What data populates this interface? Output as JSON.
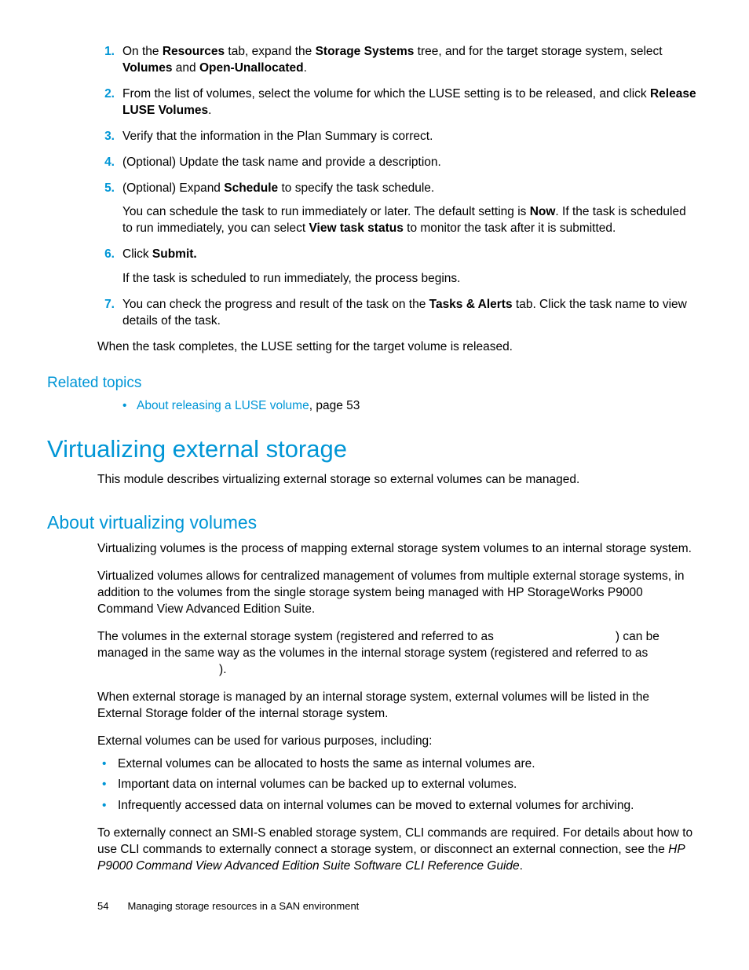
{
  "steps": [
    {
      "n": "1.",
      "parts": [
        {
          "t": "On the "
        },
        {
          "t": "Resources",
          "b": true
        },
        {
          "t": " tab, expand the "
        },
        {
          "t": "Storage Systems",
          "b": true
        },
        {
          "t": " tree, and for the target storage system, select "
        },
        {
          "t": "Volumes",
          "b": true
        },
        {
          "t": " and "
        },
        {
          "t": "Open-Unallocated",
          "b": true
        },
        {
          "t": "."
        }
      ]
    },
    {
      "n": "2.",
      "parts": [
        {
          "t": "From the list of volumes, select the volume for which the LUSE setting is to be released, and click "
        },
        {
          "t": "Release LUSE Volumes",
          "b": true
        },
        {
          "t": "."
        }
      ]
    },
    {
      "n": "3.",
      "parts": [
        {
          "t": "Verify that the information in the Plan Summary is correct."
        }
      ]
    },
    {
      "n": "4.",
      "parts": [
        {
          "t": "(Optional) Update the task name and provide a description."
        }
      ]
    },
    {
      "n": "5.",
      "parts": [
        {
          "t": "(Optional) Expand "
        },
        {
          "t": "Schedule",
          "b": true
        },
        {
          "t": " to specify the task schedule."
        }
      ],
      "sub": [
        {
          "t": "You can schedule the task to run immediately or later. The default setting is "
        },
        {
          "t": "Now",
          "b": true
        },
        {
          "t": ". If the task is scheduled to run immediately, you can select "
        },
        {
          "t": "View task status",
          "b": true
        },
        {
          "t": " to monitor the task after it is submitted."
        }
      ]
    },
    {
      "n": "6.",
      "parts": [
        {
          "t": "Click "
        },
        {
          "t": "Submit.",
          "b": true
        }
      ],
      "sub": [
        {
          "t": "If the task is scheduled to run immediately, the process begins."
        }
      ]
    },
    {
      "n": "7.",
      "parts": [
        {
          "t": "You can check the progress and result of the task on the "
        },
        {
          "t": "Tasks & Alerts",
          "b": true
        },
        {
          "t": " tab. Click the task name to view details of the task."
        }
      ]
    }
  ],
  "after_steps": "When the task completes, the LUSE setting for the target volume is released.",
  "related_heading": "Related topics",
  "related_link": "About releasing a LUSE volume",
  "related_after": ", page 53",
  "h1": "Virtualizing external storage",
  "h1_intro": "This module describes virtualizing external storage so external volumes can be managed.",
  "h2": "About virtualizing volumes",
  "p1": "Virtualizing volumes is the process of mapping external storage system volumes to an internal storage system.",
  "p2": "Virtualized volumes allows for centralized management of volumes from multiple external storage systems, in addition to the volumes from the single storage system being managed with HP StorageWorks P9000 Command View Advanced Edition Suite.",
  "p3_a": "The volumes in the external storage system (registered and referred to as ",
  "p3_gap1": "                                   ",
  "p3_b": ") can be managed in the same way as the volumes in the internal storage system (registered and referred to as ",
  "p3_gap2": "                                    ",
  "p3_c": ").",
  "p4": "When external storage is managed by an internal storage system, external volumes will be listed in the External Storage folder of the internal storage system.",
  "p5": "External volumes can be used for various purposes, including:",
  "bul": [
    "External volumes can be allocated to hosts the same as internal volumes are.",
    "Important data on internal volumes can be backed up to external volumes.",
    "Infrequently accessed data on internal volumes can be moved to external volumes for archiving."
  ],
  "p6_a": "To externally connect an SMI-S enabled storage system, CLI commands are required. For details about how to use CLI commands to externally connect a storage system, or disconnect an external connection, see the ",
  "p6_i": "HP P9000 Command View Advanced Edition Suite Software CLI Reference Guide",
  "p6_b": ".",
  "footer_page": "54",
  "footer_text": "Managing storage resources in a SAN environment"
}
